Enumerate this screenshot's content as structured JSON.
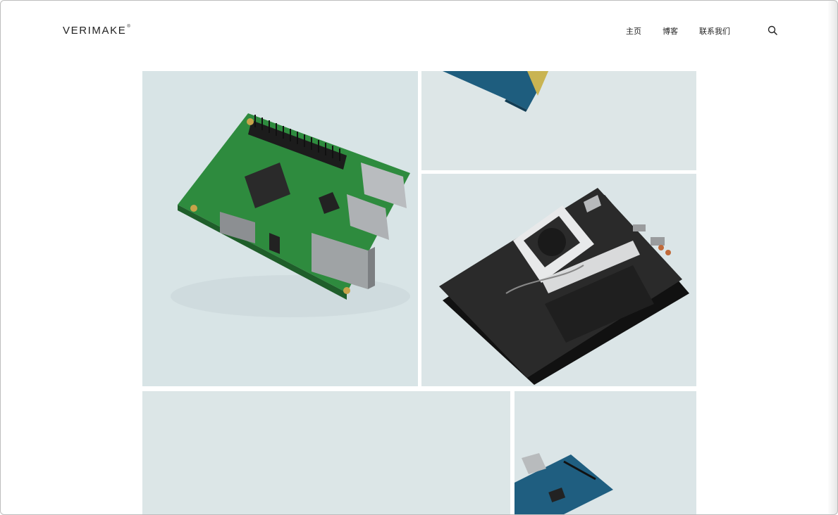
{
  "header": {
    "logo_text": "VERIMAKE",
    "logo_mark": "®",
    "nav": [
      {
        "label": "主页"
      },
      {
        "label": "博客"
      },
      {
        "label": "联系我们"
      }
    ],
    "search_icon": "search-icon"
  },
  "gallery": {
    "images": [
      {
        "subject": "raspberry-pi-board"
      },
      {
        "subject": "arduino-board-partial"
      },
      {
        "subject": "nvidia-jetson-tx2-board"
      },
      {
        "subject": "empty-background"
      },
      {
        "subject": "arduino-board"
      }
    ]
  }
}
